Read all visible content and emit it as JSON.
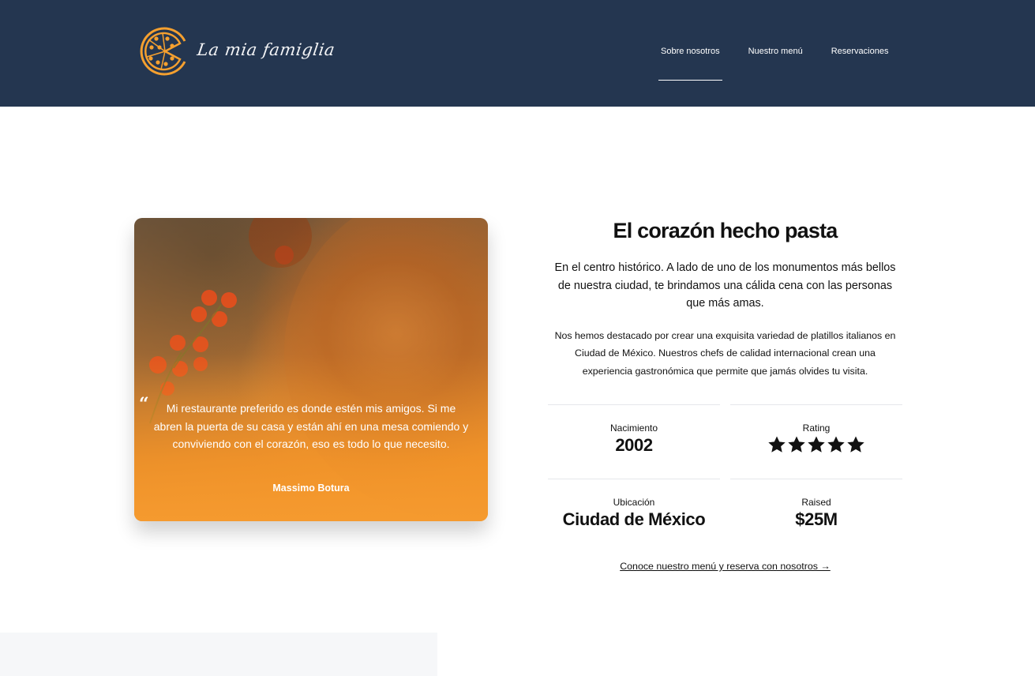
{
  "brand": {
    "name": "La mia famiglia",
    "accent_color": "#F5A02F",
    "logo_icon": "pizza-icon"
  },
  "nav": {
    "items": [
      {
        "label": "Sobre nosotros",
        "active": true
      },
      {
        "label": "Nuestro menú",
        "active": false
      },
      {
        "label": "Reservaciones",
        "active": false
      }
    ],
    "background_color": "#243650"
  },
  "hero": {
    "image_alt": "Pizza con tomates cherry",
    "quote": "Mi restaurante preferido es donde estén mis amigos. Si me abren la puerta de su casa y están ahí en una mesa comiendo y conviviendo con el corazón, eso es todo lo que necesito.",
    "author": "Massimo Botura",
    "quote_icon": "quote-icon"
  },
  "info": {
    "title": "El corazón hecho pasta",
    "lead": "En el centro histórico. A lado de uno de los monumentos más bellos de nuestra ciudad, te brindamos una cálida cena con las personas que más amas.",
    "body": "Nos hemos destacado por crear una exquisita variedad de platillos italianos en Ciudad de México. Nuestros chefs de calidad internacional crean una experiencia gastronómica que permite que jamás olvides tu visita."
  },
  "stats": [
    {
      "label": "Nacimiento",
      "value": "2002"
    },
    {
      "label": "Rating",
      "rating": 5,
      "max": 5,
      "icon": "star-icon"
    },
    {
      "label": "Ubicación",
      "value": "Ciudad de México"
    },
    {
      "label": "Raised",
      "value": "$25M"
    }
  ],
  "cta": {
    "label": "Conoce nuestro menú y reserva con nosotros →"
  }
}
